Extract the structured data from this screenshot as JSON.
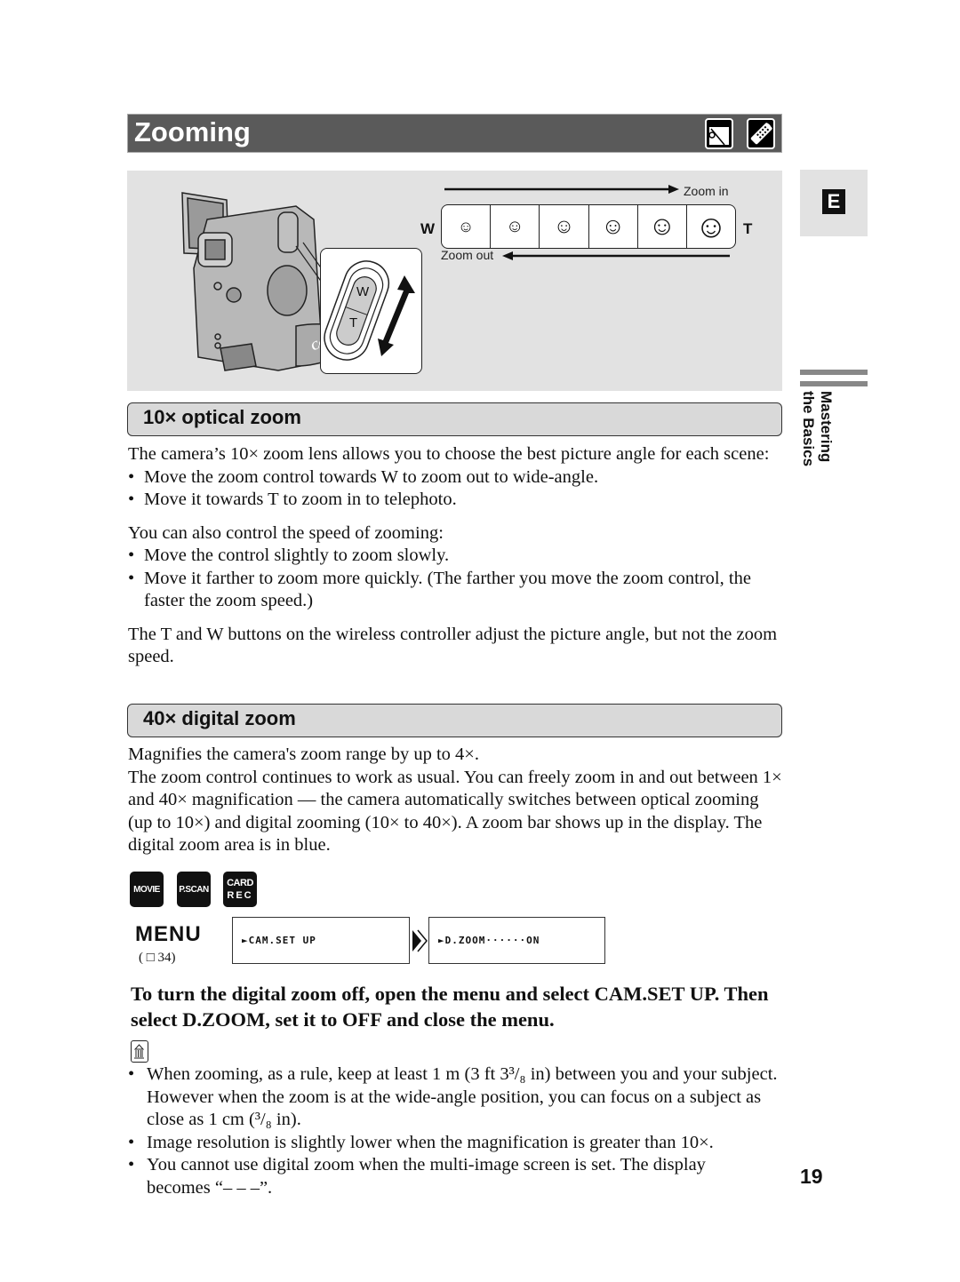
{
  "header": {
    "title": "Zooming",
    "mode_icons": [
      "camera-mode-icon",
      "wireless-controller-icon"
    ]
  },
  "illustration": {
    "zoom_in_label": "Zoom in",
    "zoom_out_label": "Zoom out",
    "wide_label": "W",
    "tele_label": "T",
    "lever_w": "W",
    "lever_t": "T",
    "brand": "Canon",
    "frame_count": 6
  },
  "side_tab": {
    "language": "E",
    "section_line1": "Mastering",
    "section_line2": "the Basics"
  },
  "optical": {
    "heading": "10× optical zoom",
    "intro": "The camera’s 10× zoom lens allows you to choose the best picture angle for each scene:",
    "bullets1": [
      "Move the zoom control towards W to zoom out to wide-angle.",
      "Move it towards T to zoom in to telephoto."
    ],
    "speed_intro": "You can also control the speed of zooming:",
    "bullets2": [
      "Move the control slightly to zoom slowly.",
      "Move it farther to zoom more quickly. (The farther you move the zoom control, the faster the zoom speed.)"
    ],
    "wireless_note": "The T and W buttons on the wireless controller adjust the picture angle, but not the zoom speed."
  },
  "digital": {
    "heading": "40× digital zoom",
    "line1": "Magnifies the camera's zoom range by up to 4×.",
    "line2": "The zoom control continues to work as usual. You can freely zoom in and out between 1× and 40× magnification — the camera automatically switches between optical zooming (up to 10×) and digital zooming (10× to 40×). A zoom bar shows up in the display. The digital zoom area is in blue."
  },
  "modes": {
    "movie": "MOVIE",
    "pscan": "P.SCAN",
    "card": "CARD",
    "rec": "REC"
  },
  "menu": {
    "label": "MENU",
    "reference": "( □ 34)",
    "screen1": "►CAM.SET UP",
    "screen2": "►D.ZOOM······ON"
  },
  "instruction": "To turn the digital zoom off, open the menu and select CAM.SET UP. Then select D.ZOOM, set it to OFF and close the menu.",
  "notes": [
    "When zooming, as a rule, keep at least 1 m (3 ft 3³/₈ in) between you and your subject. However when the zoom is at the wide-angle position, you can focus on a subject as close as 1 cm (³/₈ in).",
    "Image resolution is slightly lower when the magnification is greater than 10×.",
    "You cannot use digital zoom when the multi-image screen is set. The display becomes “– – –”."
  ],
  "page_number": "19"
}
